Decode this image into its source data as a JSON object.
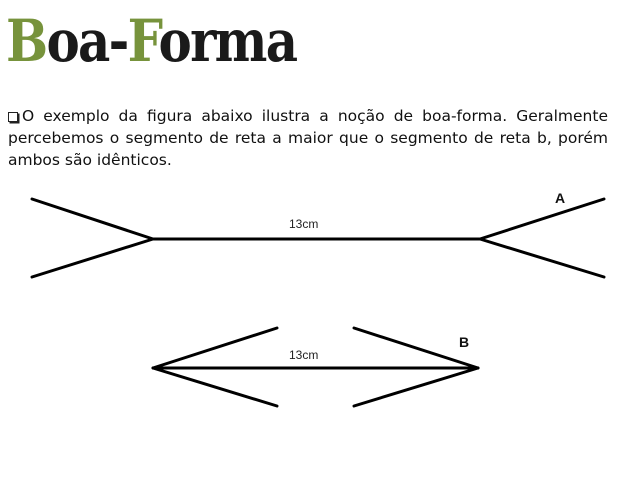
{
  "title": {
    "first_letter": "B",
    "part1": "oa-",
    "second_letter": "F",
    "part2": "orma"
  },
  "paragraph": "O exemplo da figura abaixo ilustra a noção de boa-forma. Geralmente percebemos o segmento de reta a maior que o segmento de reta b, porém ambos são idênticos.",
  "figure": {
    "segment_a": {
      "label": "A",
      "length": "13cm"
    },
    "segment_b": {
      "label": "B",
      "length": "13cm"
    }
  },
  "colors": {
    "accent": "#77933c",
    "title_dark": "#1a1a1a",
    "line": "#000000"
  },
  "icons": {
    "bullet": "square-bullet-icon"
  }
}
